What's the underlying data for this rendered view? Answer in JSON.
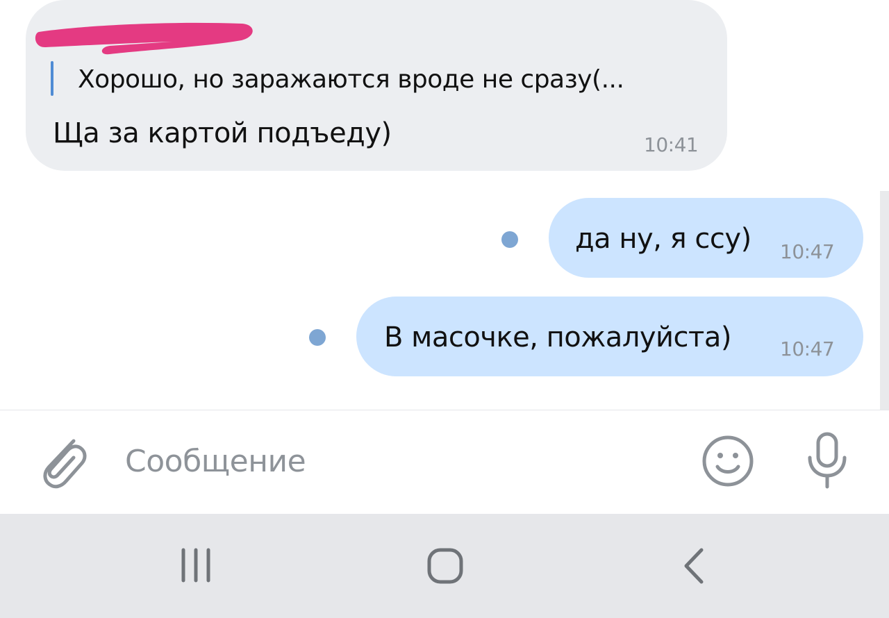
{
  "chat": {
    "incoming": {
      "sender_redacted": true,
      "reply_quote": "Хорошо, но заражаются вроде не сразу(...",
      "text": "Ща за картой подъеду)",
      "time": "10:41"
    },
    "outgoing": [
      {
        "text": "да ну, я ссу)",
        "time": "10:47",
        "unread": true
      },
      {
        "text": "В масочке, пожалуйста)",
        "time": "10:47",
        "unread": true
      }
    ]
  },
  "composer": {
    "placeholder": "Сообщение",
    "attach_icon": "paperclip-icon",
    "emoji_icon": "smiley-icon",
    "mic_icon": "microphone-icon"
  },
  "system_nav": {
    "recents_icon": "recents-icon",
    "home_icon": "home-icon",
    "back_icon": "back-chevron-icon"
  },
  "colors": {
    "incoming_bubble": "#eceef1",
    "outgoing_bubble": "#cce4ff",
    "quote_accent": "#4f8bd4",
    "unread_dot": "#7ea6d3",
    "redaction_marker": "#e43a82",
    "nav_bar": "#e6e7ea"
  }
}
